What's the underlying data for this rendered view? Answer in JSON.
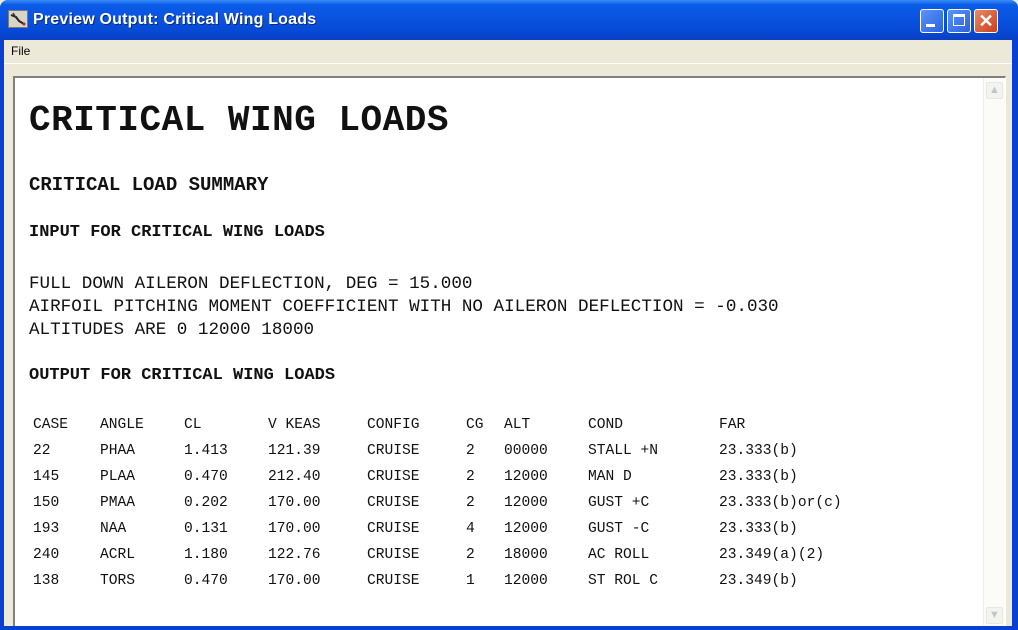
{
  "window": {
    "title": "Preview Output: Critical Wing Loads",
    "controls": {
      "minimize": "minimize",
      "maximize": "maximize",
      "close": "✕"
    }
  },
  "menubar": {
    "items": [
      {
        "label": "File"
      }
    ]
  },
  "document": {
    "title": "CRITICAL WING LOADS",
    "summary_heading": "CRITICAL LOAD SUMMARY",
    "input_heading": "INPUT FOR CRITICAL WING LOADS",
    "input_lines": [
      "FULL DOWN AILERON DEFLECTION, DEG = 15.000",
      "AIRFOIL PITCHING MOMENT COEFFICIENT WITH NO AILERON DEFLECTION = -0.030",
      "ALTITUDES ARE 0 12000 18000"
    ],
    "output_heading": "OUTPUT FOR CRITICAL WING LOADS",
    "table": {
      "columns": [
        "CASE",
        "ANGLE",
        "CL",
        "V KEAS",
        "CONFIG",
        "CG",
        "ALT",
        "COND",
        "FAR"
      ],
      "rows": [
        [
          "22",
          "PHAA",
          "1.413",
          "121.39",
          "CRUISE",
          "2",
          "00000",
          "STALL +N",
          "23.333(b)"
        ],
        [
          "145",
          "PLAA",
          "0.470",
          "212.40",
          "CRUISE",
          "2",
          "12000",
          "MAN D",
          "23.333(b)"
        ],
        [
          "150",
          "PMAA",
          "0.202",
          "170.00",
          "CRUISE",
          "2",
          "12000",
          "GUST +C",
          "23.333(b)or(c)"
        ],
        [
          "193",
          "NAA",
          "0.131",
          "170.00",
          "CRUISE",
          "4",
          "12000",
          "GUST -C",
          "23.333(b)"
        ],
        [
          "240",
          "ACRL",
          "1.180",
          "122.76",
          "CRUISE",
          "2",
          "18000",
          "AC ROLL",
          "23.349(a)(2)"
        ],
        [
          "138",
          "TORS",
          "0.470",
          "170.00",
          "CRUISE",
          "1",
          "12000",
          "ST ROL C",
          "23.349(b)"
        ]
      ]
    }
  },
  "scrollbar": {
    "up": "▲",
    "down": "▼"
  }
}
